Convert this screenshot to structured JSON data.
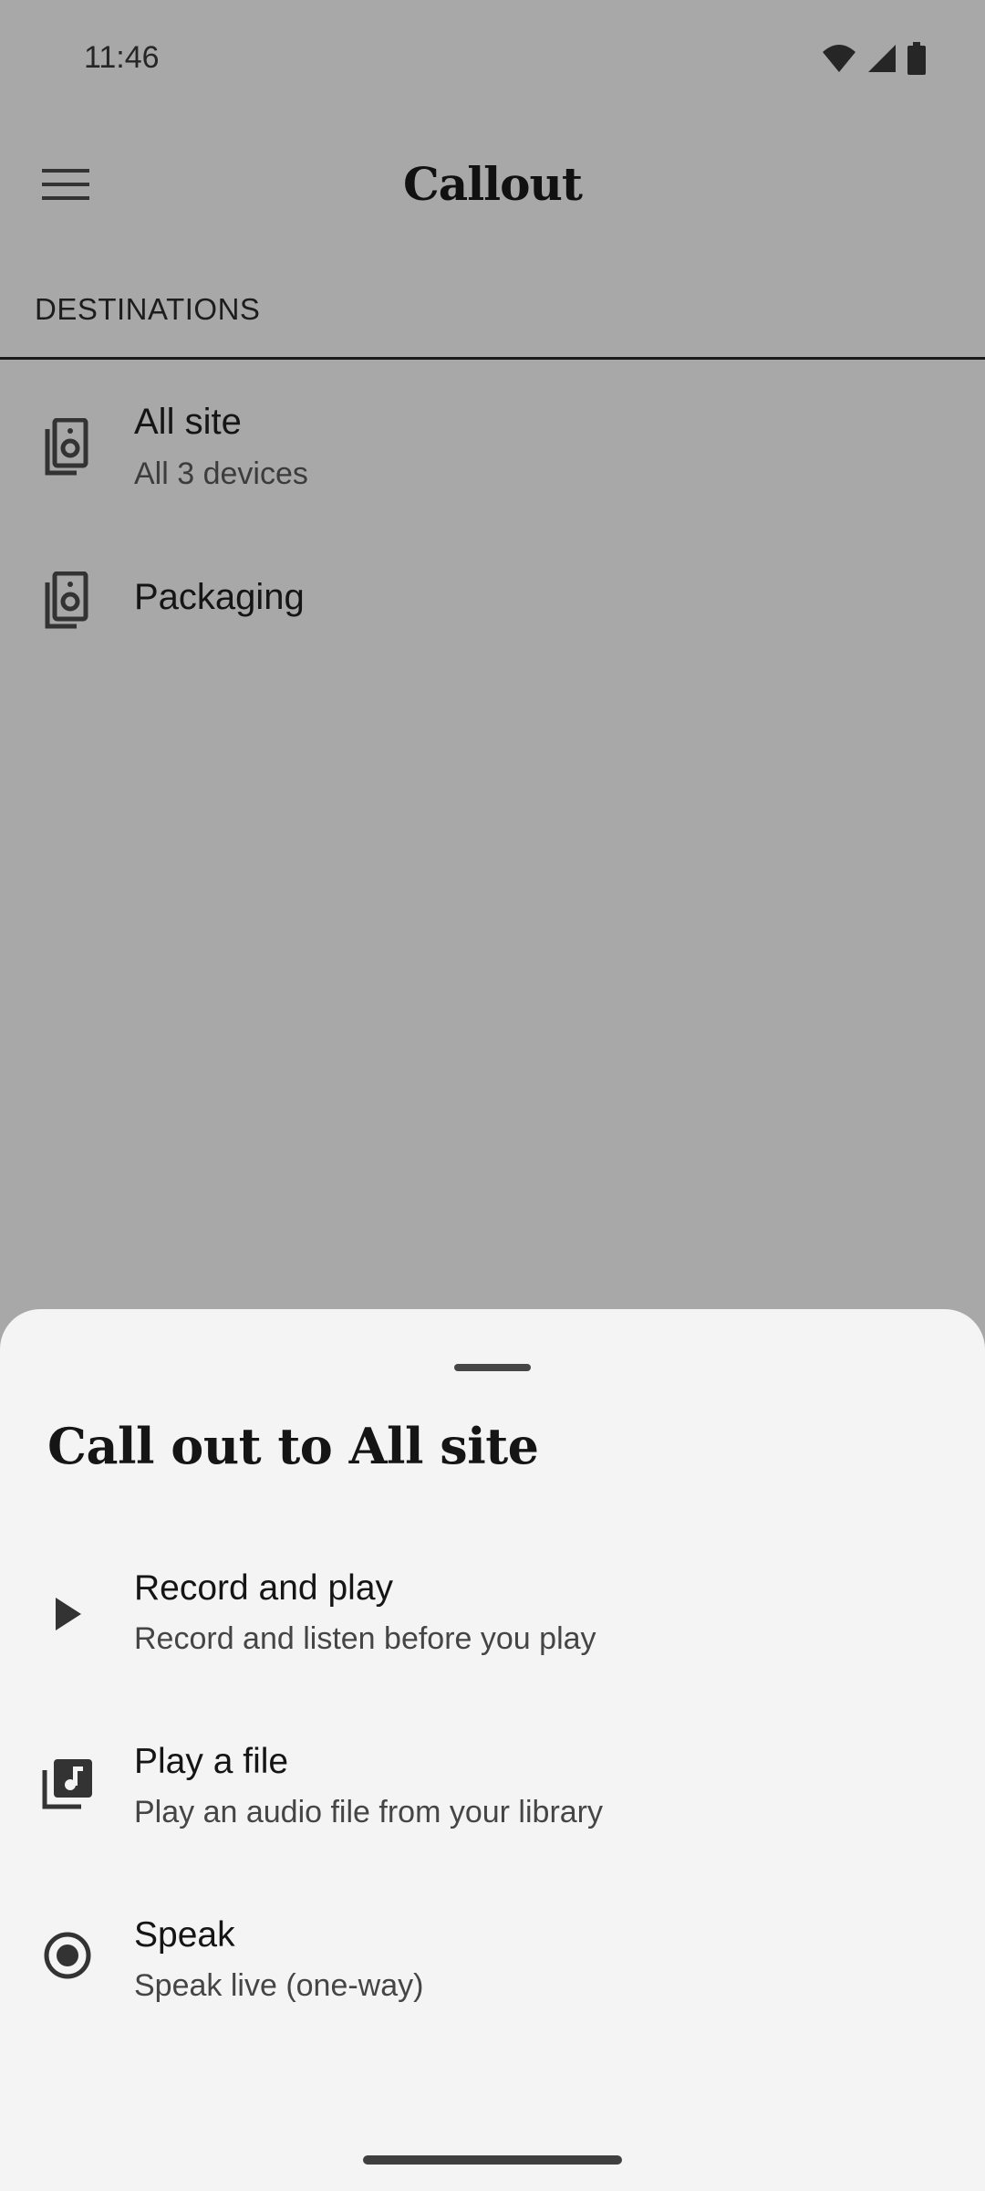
{
  "status_bar": {
    "time": "11:46",
    "icons": [
      "wifi-icon",
      "cellular-signal-icon",
      "battery-icon"
    ]
  },
  "app_bar": {
    "menu_icon": "hamburger-menu-icon",
    "title": "Callout"
  },
  "destinations": {
    "header": "DESTINATIONS",
    "items": [
      {
        "title": "All site",
        "subtitle": "All 3 devices",
        "icon": "speaker-group-icon"
      },
      {
        "title": "Packaging",
        "subtitle": "",
        "icon": "speaker-group-icon"
      }
    ]
  },
  "sheet": {
    "title": "Call out to All site",
    "options": [
      {
        "title": "Record and play",
        "subtitle": "Record and listen before you play",
        "icon": "play-icon"
      },
      {
        "title": "Play a file",
        "subtitle": "Play an audio file from your library",
        "icon": "music-library-icon"
      },
      {
        "title": "Speak",
        "subtitle": "Speak live (one-way)",
        "icon": "radio-live-icon"
      }
    ]
  },
  "colors": {
    "scrim_background": "#a8a8a8",
    "sheet_background": "#f4f4f4",
    "text_primary": "#151515"
  }
}
